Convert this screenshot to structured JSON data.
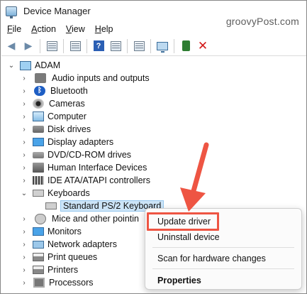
{
  "window": {
    "title": "Device Manager",
    "watermark": "groovyPost.com"
  },
  "menubar": {
    "items": [
      {
        "label": "File",
        "key": "F",
        "rest": "ile"
      },
      {
        "label": "Action",
        "key": "A",
        "rest": "ction"
      },
      {
        "label": "View",
        "key": "V",
        "rest": "iew"
      },
      {
        "label": "Help",
        "key": "H",
        "rest": "elp"
      }
    ]
  },
  "toolbar": {
    "icons": [
      "back-arrow-icon",
      "forward-arrow-icon",
      "properties-icon",
      "list-icon",
      "help-icon",
      "view-icon",
      "scan-icon",
      "monitor-icon",
      "enable-device-icon",
      "uninstall-x-icon"
    ]
  },
  "tree": {
    "root": "ADAM",
    "categories": [
      {
        "label": "Audio inputs and outputs",
        "icon": "speaker-icon"
      },
      {
        "label": "Bluetooth",
        "icon": "bluetooth-icon"
      },
      {
        "label": "Cameras",
        "icon": "camera-icon"
      },
      {
        "label": "Computer",
        "icon": "computer-icon"
      },
      {
        "label": "Disk drives",
        "icon": "disk-icon"
      },
      {
        "label": "Display adapters",
        "icon": "display-adapter-icon"
      },
      {
        "label": "DVD/CD-ROM drives",
        "icon": "dvd-icon"
      },
      {
        "label": "Human Interface Devices",
        "icon": "hid-icon"
      },
      {
        "label": "IDE ATA/ATAPI controllers",
        "icon": "ide-icon"
      },
      {
        "label": "Keyboards",
        "icon": "keyboard-icon",
        "expanded": true
      },
      {
        "label": "Standard PS/2 Keyboard",
        "icon": "keyboard-icon",
        "child": true,
        "selected": true
      },
      {
        "label": "Mice and other pointin",
        "icon": "mouse-icon"
      },
      {
        "label": "Monitors",
        "icon": "monitor-icon"
      },
      {
        "label": "Network adapters",
        "icon": "network-icon"
      },
      {
        "label": "Print queues",
        "icon": "print-queue-icon"
      },
      {
        "label": "Printers",
        "icon": "printer-icon"
      },
      {
        "label": "Processors",
        "icon": "processor-icon"
      }
    ]
  },
  "context_menu": {
    "update_driver": "Update driver",
    "uninstall_device": "Uninstall device",
    "scan_hardware": "Scan for hardware changes",
    "properties": "Properties"
  },
  "colors": {
    "annotation": "#ee5543",
    "selection": "#cce4f7"
  }
}
